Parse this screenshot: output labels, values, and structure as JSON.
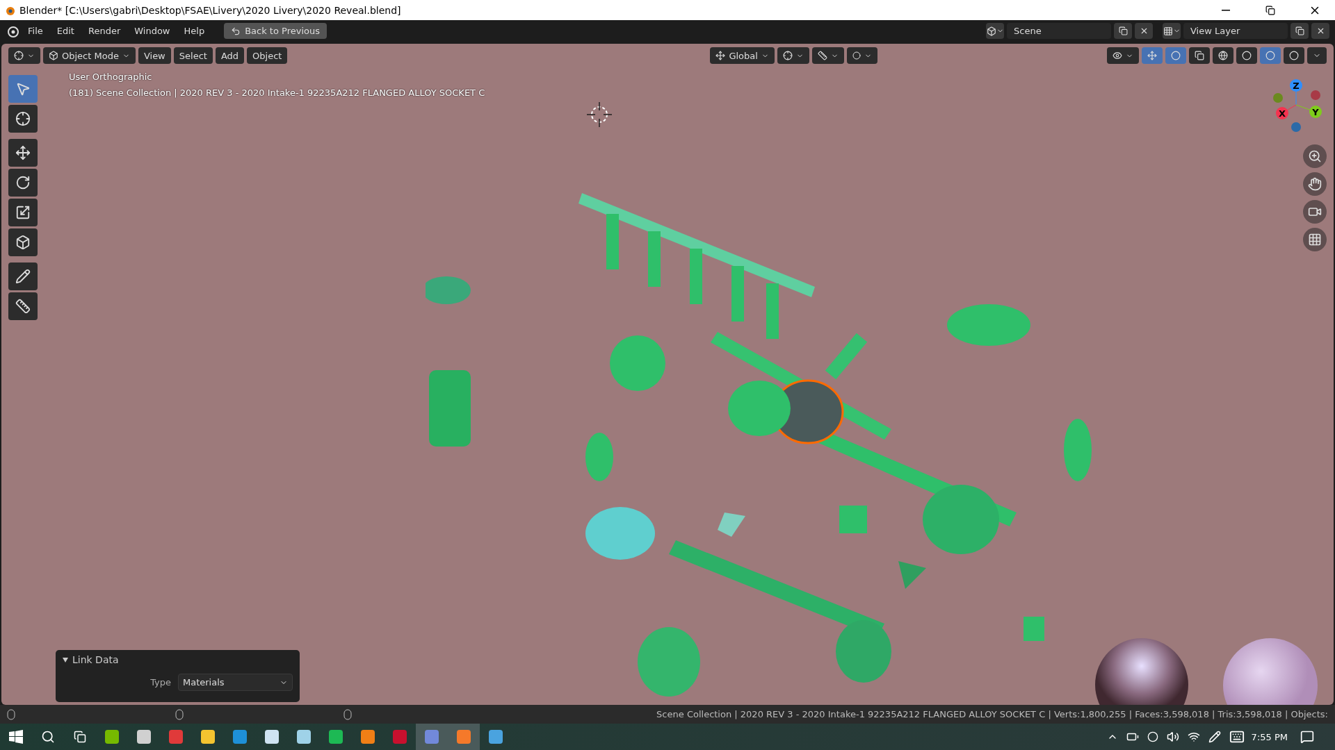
{
  "window": {
    "title": "Blender* [C:\\Users\\gabri\\Desktop\\FSAE\\Livery\\2020 Livery\\2020 Reveal.blend]"
  },
  "menu": [
    "File",
    "Edit",
    "Render",
    "Window",
    "Help"
  ],
  "back_button": "Back to Previous",
  "scene": "Scene",
  "view_layer": "View Layer",
  "viewport_header": {
    "mode": "Object Mode",
    "menus": [
      "View",
      "Select",
      "Add",
      "Object"
    ],
    "orientation": "Global"
  },
  "shading": [
    {
      "kind": "wireframe",
      "selected": false
    },
    {
      "kind": "solid",
      "selected": false
    },
    {
      "kind": "material",
      "selected": true
    },
    {
      "kind": "rendered",
      "selected": false
    }
  ],
  "overlay": {
    "view_name": "User Orthographic",
    "object_info": "(181) Scene Collection | 2020 REV 3 - 2020 Intake-1 92235A212 FLANGED ALLOY SOCKET C"
  },
  "tools": [
    {
      "kind": "select",
      "selected": true
    },
    {
      "kind": "cursor",
      "selected": false
    },
    {
      "kind": "move",
      "selected": false
    },
    {
      "kind": "rotate",
      "selected": false
    },
    {
      "kind": "scale",
      "selected": false
    },
    {
      "kind": "transform",
      "selected": false
    },
    {
      "kind": "annotate",
      "selected": false
    },
    {
      "kind": "measure",
      "selected": false
    }
  ],
  "gizmo": [
    {
      "label": "X",
      "color": "#f5334f"
    },
    {
      "label": "Y",
      "color": "#7fcc1c"
    },
    {
      "label": "Z",
      "color": "#2e8fff"
    }
  ],
  "link_data": {
    "title": "Link Data",
    "type_label": "Type",
    "type_value": "Materials"
  },
  "status_bar": "Scene Collection | 2020 REV 3 - 2020 Intake-1 92235A212 FLANGED ALLOY SOCKET C | Verts:1,800,255 | Faces:3,598,018 | Tris:3,598,018 | Objects:",
  "taskbar": {
    "time": "7:55 PM",
    "apps": [
      {
        "color": "#76b900",
        "active": false
      },
      {
        "color": "#d0d0d0",
        "active": false
      },
      {
        "color": "#e03a3a",
        "active": false
      },
      {
        "color": "#f4c430",
        "active": false
      },
      {
        "color": "#1e90d8",
        "active": false
      },
      {
        "color": "#cfe3f2",
        "active": false
      },
      {
        "color": "#9fd2e8",
        "active": false
      },
      {
        "color": "#1db954",
        "active": false
      },
      {
        "color": "#f07f16",
        "active": false
      },
      {
        "color": "#c8102e",
        "active": false
      },
      {
        "color": "#7289da",
        "active": true
      },
      {
        "color": "#f5792a",
        "active": true
      },
      {
        "color": "#4aa3df",
        "active": false
      }
    ]
  }
}
